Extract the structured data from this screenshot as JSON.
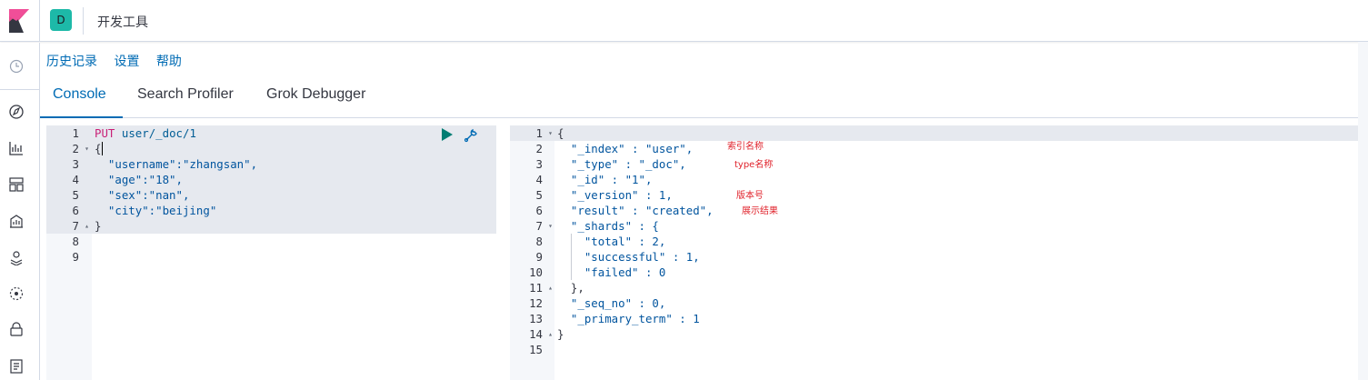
{
  "header": {
    "space_initial": "D",
    "title": "开发工具"
  },
  "menu": {
    "history": "历史记录",
    "settings": "设置",
    "help": "帮助"
  },
  "tabs": [
    {
      "label": "Console"
    },
    {
      "label": "Search Profiler"
    },
    {
      "label": "Grok Debugger"
    }
  ],
  "request": {
    "line_numbers": [
      "1",
      "2",
      "3",
      "4",
      "5",
      "6",
      "7",
      "8",
      "9"
    ],
    "method": "PUT",
    "url": "user/_doc/1",
    "lines": [
      "{",
      "  \"username\":\"zhangsan\",",
      "  \"age\":\"18\",",
      "  \"sex\":\"nan\",",
      "  \"city\":\"beijing\"",
      "}"
    ]
  },
  "response": {
    "line_numbers": [
      "1",
      "2",
      "3",
      "4",
      "5",
      "6",
      "7",
      "8",
      "9",
      "10",
      "11",
      "12",
      "13",
      "14",
      "15"
    ],
    "lines": [
      "{",
      "  \"_index\" : \"user\",",
      "  \"_type\" : \"_doc\",",
      "  \"_id\" : \"1\",",
      "  \"_version\" : 1,",
      "  \"result\" : \"created\",",
      "  \"_shards\" : {",
      "    \"total\" : 2,",
      "    \"successful\" : 1,",
      "    \"failed\" : 0",
      "  },",
      "  \"_seq_no\" : 0,",
      "  \"_primary_term\" : 1",
      "}",
      ""
    ]
  },
  "annotations": {
    "index": "索引名称",
    "type": "type名称",
    "version": "版本号",
    "result": "展示结果"
  },
  "colors": {
    "accent": "#006bb4",
    "run_button": "#017d73",
    "space_avatar": "#1db9a8",
    "annotation": "#e0222b"
  }
}
